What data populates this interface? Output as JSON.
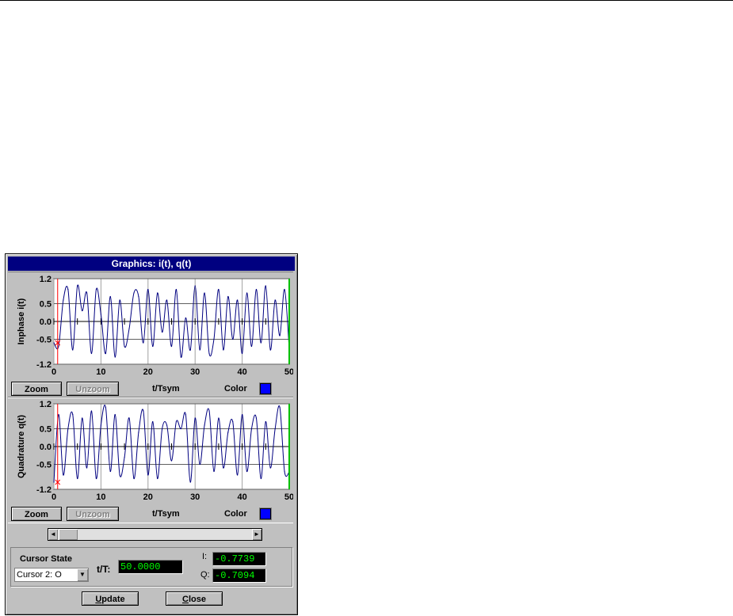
{
  "window": {
    "title": "Graphics: i(t), q(t)"
  },
  "plot1": {
    "ylabel": "Inphase i(t)",
    "xlabel": "t/Tsym",
    "yticks": [
      "1.2",
      "0.5",
      "0.0",
      "-0.5",
      "-1.2"
    ],
    "xticks": [
      "0",
      "10",
      "20",
      "30",
      "40",
      "50"
    ],
    "zoom_label": "Zoom",
    "unzoom_label": "Unzoom",
    "color_label": "Color",
    "trace_color": "#000080",
    "swatch_color": "#0000ff"
  },
  "plot2": {
    "ylabel": "Quadrature q(t)",
    "xlabel": "t/Tsym",
    "yticks": [
      "1.2",
      "0.5",
      "0.0",
      "-0.5",
      "-1.2"
    ],
    "xticks": [
      "0",
      "10",
      "20",
      "30",
      "40",
      "50"
    ],
    "zoom_label": "Zoom",
    "unzoom_label": "Unzoom",
    "color_label": "Color",
    "trace_color": "#000080",
    "swatch_color": "#0000ff"
  },
  "cursor": {
    "group_label": "Cursor State",
    "selected": "Cursor 2: O",
    "t_label": "t/T:",
    "t_value": "50.0000",
    "i_label": "I:",
    "i_value": "-0.7739",
    "q_label": "Q:",
    "q_value": "-0.7094"
  },
  "buttons": {
    "update_label": "Update",
    "close_label": "Close"
  },
  "chart_data": [
    {
      "type": "line",
      "xlabel": "t/Tsym",
      "ylabel": "Inphase i(t)",
      "xlim": [
        0,
        50
      ],
      "ylim": [
        -1.2,
        1.2
      ],
      "cursors": [
        {
          "name": "Cursor 1",
          "x": 0.8,
          "color": "#ff0000"
        },
        {
          "name": "Cursor 2",
          "x": 50,
          "color": "#00c000"
        }
      ],
      "x": [
        0,
        1,
        2,
        3,
        4,
        5,
        6,
        7,
        8,
        9,
        10,
        11,
        12,
        13,
        14,
        15,
        16,
        17,
        18,
        19,
        20,
        21,
        22,
        23,
        24,
        25,
        26,
        27,
        28,
        29,
        30,
        31,
        32,
        33,
        34,
        35,
        36,
        37,
        38,
        39,
        40,
        41,
        42,
        43,
        44,
        45,
        46,
        47,
        48,
        49,
        50
      ],
      "y": [
        -0.6,
        -0.7,
        0.6,
        0.9,
        -0.8,
        1.0,
        0.3,
        0.8,
        -0.9,
        0.9,
        0.2,
        -0.9,
        0.7,
        -1.0,
        0.6,
        -0.7,
        -0.2,
        0.8,
        0.7,
        -0.6,
        0.9,
        -0.7,
        0.8,
        -0.3,
        0.6,
        -0.7,
        0.9,
        -1.0,
        0.1,
        -0.8,
        1.0,
        -0.8,
        0.8,
        -0.9,
        -0.5,
        0.9,
        -0.8,
        0.7,
        -0.5,
        0.6,
        -0.9,
        0.8,
        -0.7,
        0.9,
        -0.6,
        1.0,
        -0.8,
        0.6,
        -0.4,
        0.9,
        -0.77
      ]
    },
    {
      "type": "line",
      "xlabel": "t/Tsym",
      "ylabel": "Quadrature q(t)",
      "xlim": [
        0,
        50
      ],
      "ylim": [
        -1.2,
        1.2
      ],
      "cursors": [
        {
          "name": "Cursor 1",
          "x": 0.8,
          "color": "#ff0000"
        },
        {
          "name": "Cursor 2",
          "x": 50,
          "color": "#00c000"
        }
      ],
      "x": [
        0,
        1,
        2,
        3,
        4,
        5,
        6,
        7,
        8,
        9,
        10,
        11,
        12,
        13,
        14,
        15,
        16,
        17,
        18,
        19,
        20,
        21,
        22,
        23,
        24,
        25,
        26,
        27,
        28,
        29,
        30,
        31,
        32,
        33,
        34,
        35,
        36,
        37,
        38,
        39,
        40,
        41,
        42,
        43,
        44,
        45,
        46,
        47,
        48,
        49,
        50
      ],
      "y": [
        -1.0,
        0.9,
        -0.8,
        0.5,
        0.9,
        -0.9,
        0.8,
        -0.6,
        1.0,
        -0.9,
        0.6,
        1.1,
        -0.7,
        0.9,
        -0.8,
        -0.3,
        0.8,
        -0.9,
        0.4,
        1.0,
        -0.8,
        0.7,
        -0.9,
        0.5,
        0.6,
        -0.4,
        0.7,
        0.5,
        0.9,
        -1.0,
        0.8,
        -0.5,
        0.6,
        1.0,
        -0.7,
        0.8,
        -0.6,
        0.4,
        0.7,
        -0.8,
        0.9,
        -0.7,
        0.5,
        0.8,
        -0.9,
        0.7,
        -0.6,
        0.5,
        1.1,
        -0.7,
        -0.71
      ]
    }
  ]
}
